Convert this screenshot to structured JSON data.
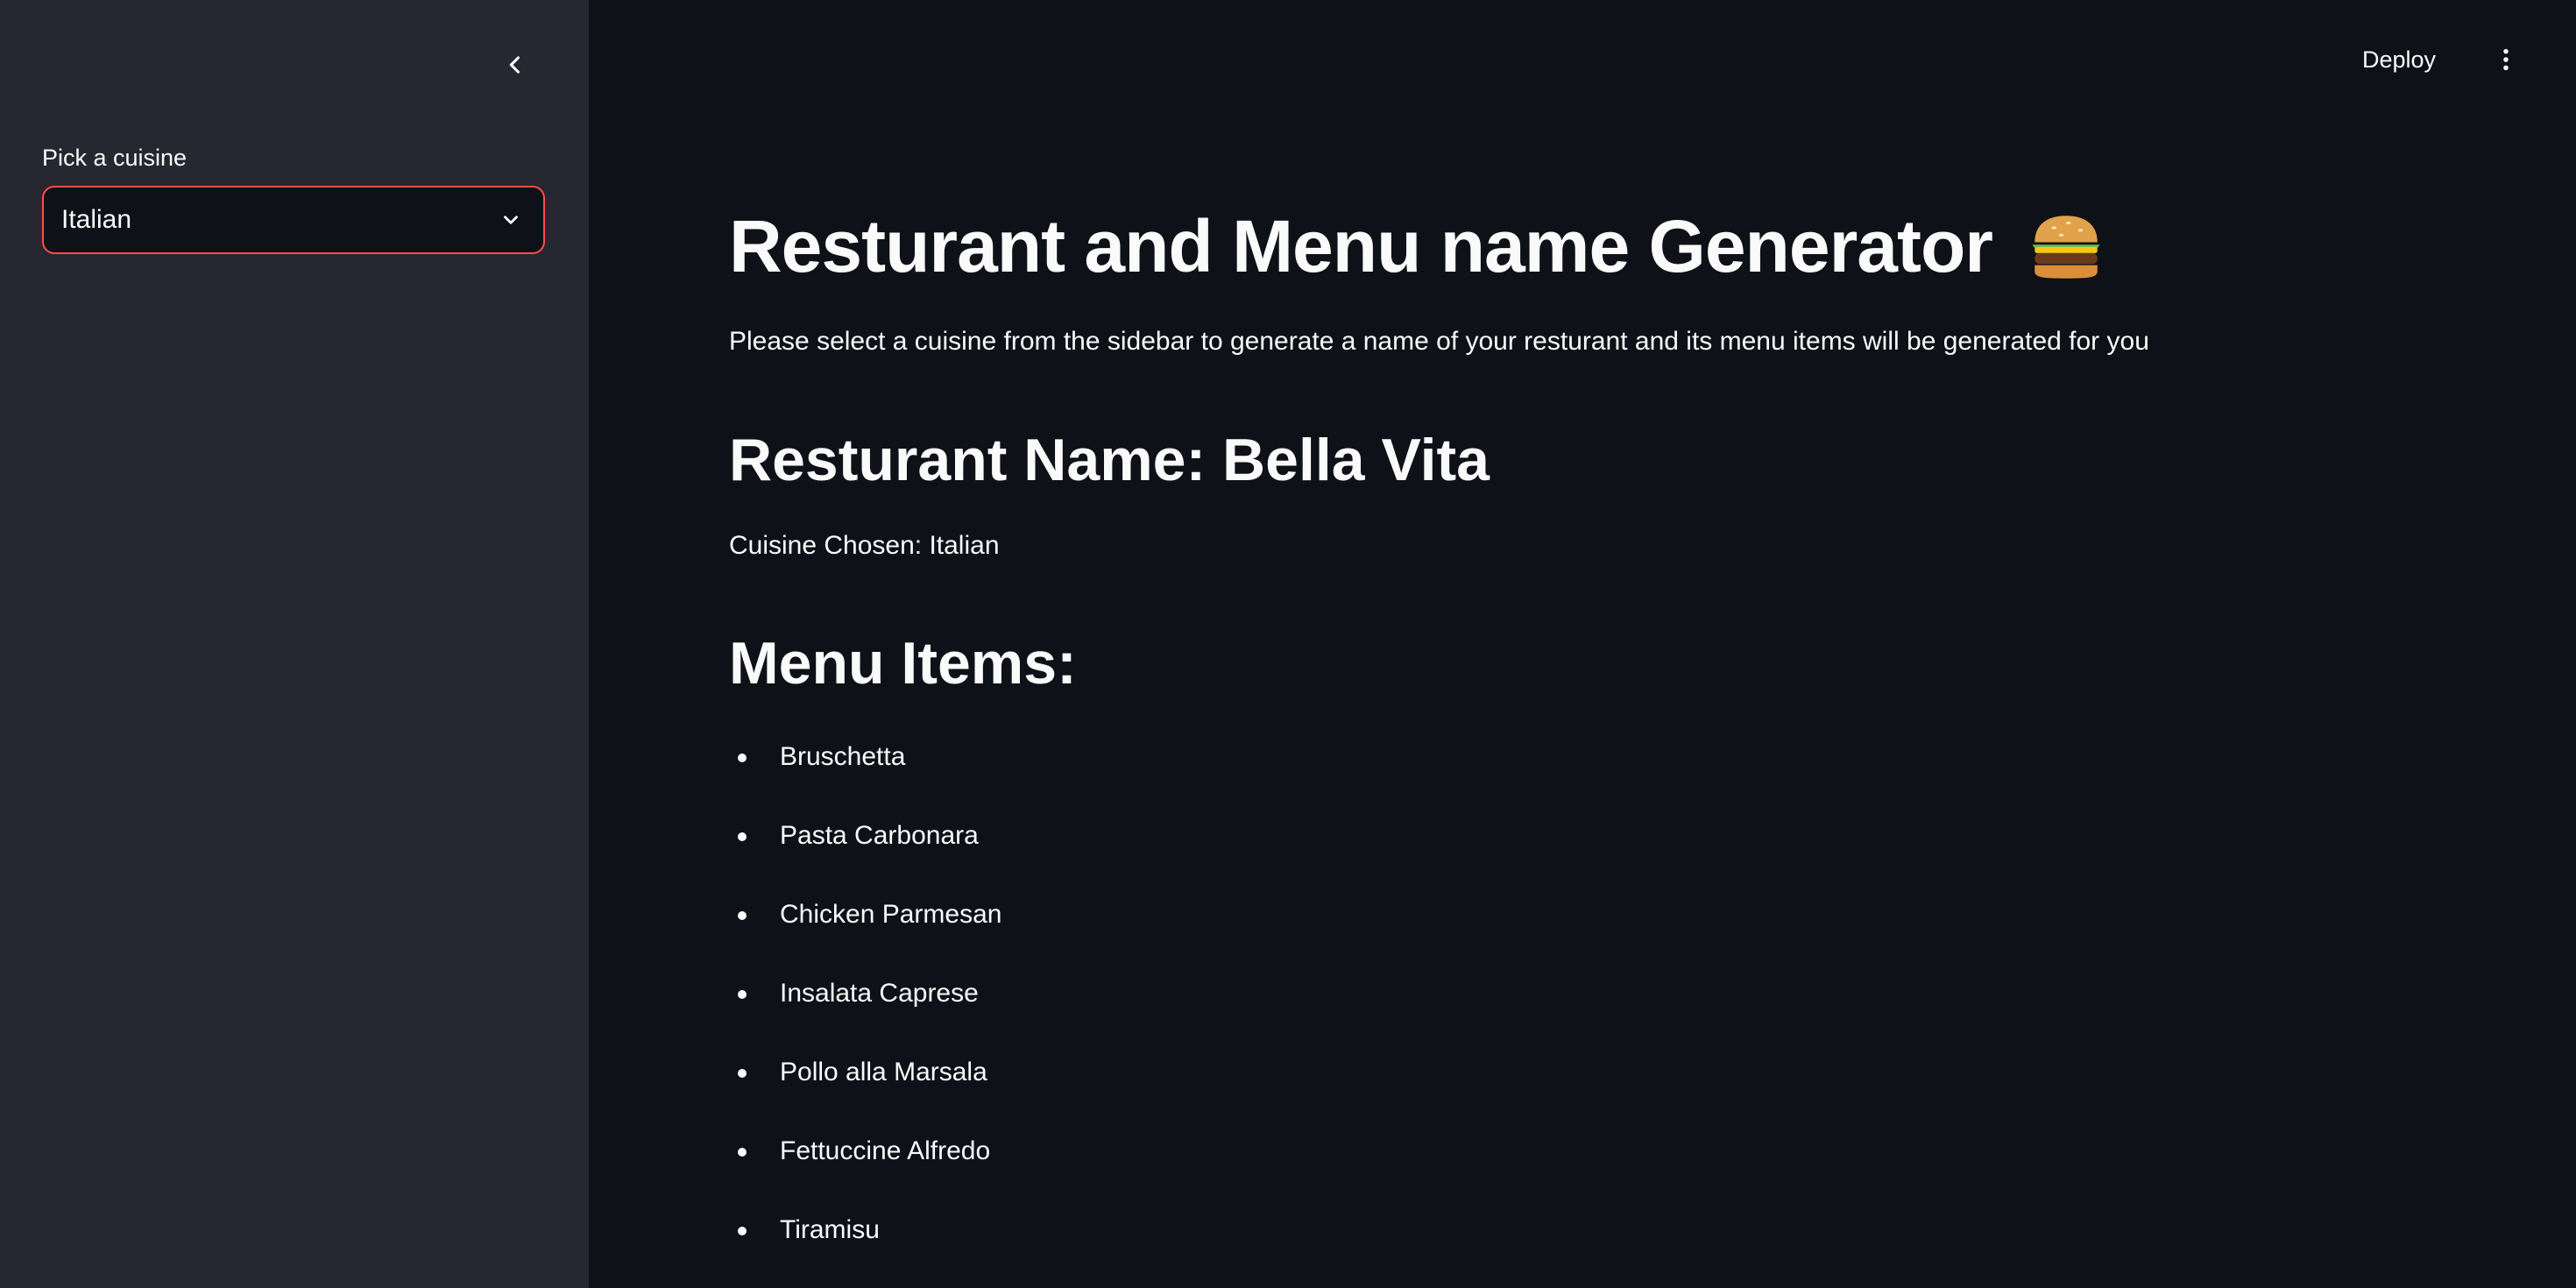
{
  "sidebar": {
    "collapse_icon": "chevron-left-icon",
    "select": {
      "label": "Pick a cuisine",
      "value": "Italian",
      "icon": "chevron-down-icon"
    }
  },
  "header": {
    "deploy_label": "Deploy",
    "menu_icon": "vertical-dots-icon"
  },
  "main": {
    "title": "Resturant and Menu name Generator",
    "title_icon": "burger-icon",
    "subtitle": "Please select a cuisine from the sidebar to generate a name of your resturant and its menu items will be generated for you",
    "restaurant_heading": "Resturant Name: Bella Vita",
    "cuisine_chosen": "Cuisine Chosen: Italian",
    "menu_heading": "Menu Items:",
    "menu_items": [
      "Bruschetta",
      "Pasta Carbonara",
      "Chicken Parmesan",
      "Insalata Caprese",
      "Pollo alla Marsala",
      "Fettuccine Alfredo",
      "Tiramisu"
    ]
  },
  "colors": {
    "sidebar_bg": "#262730",
    "main_bg": "#0e1117",
    "accent": "#ff4b4b",
    "text": "#fafafa"
  }
}
